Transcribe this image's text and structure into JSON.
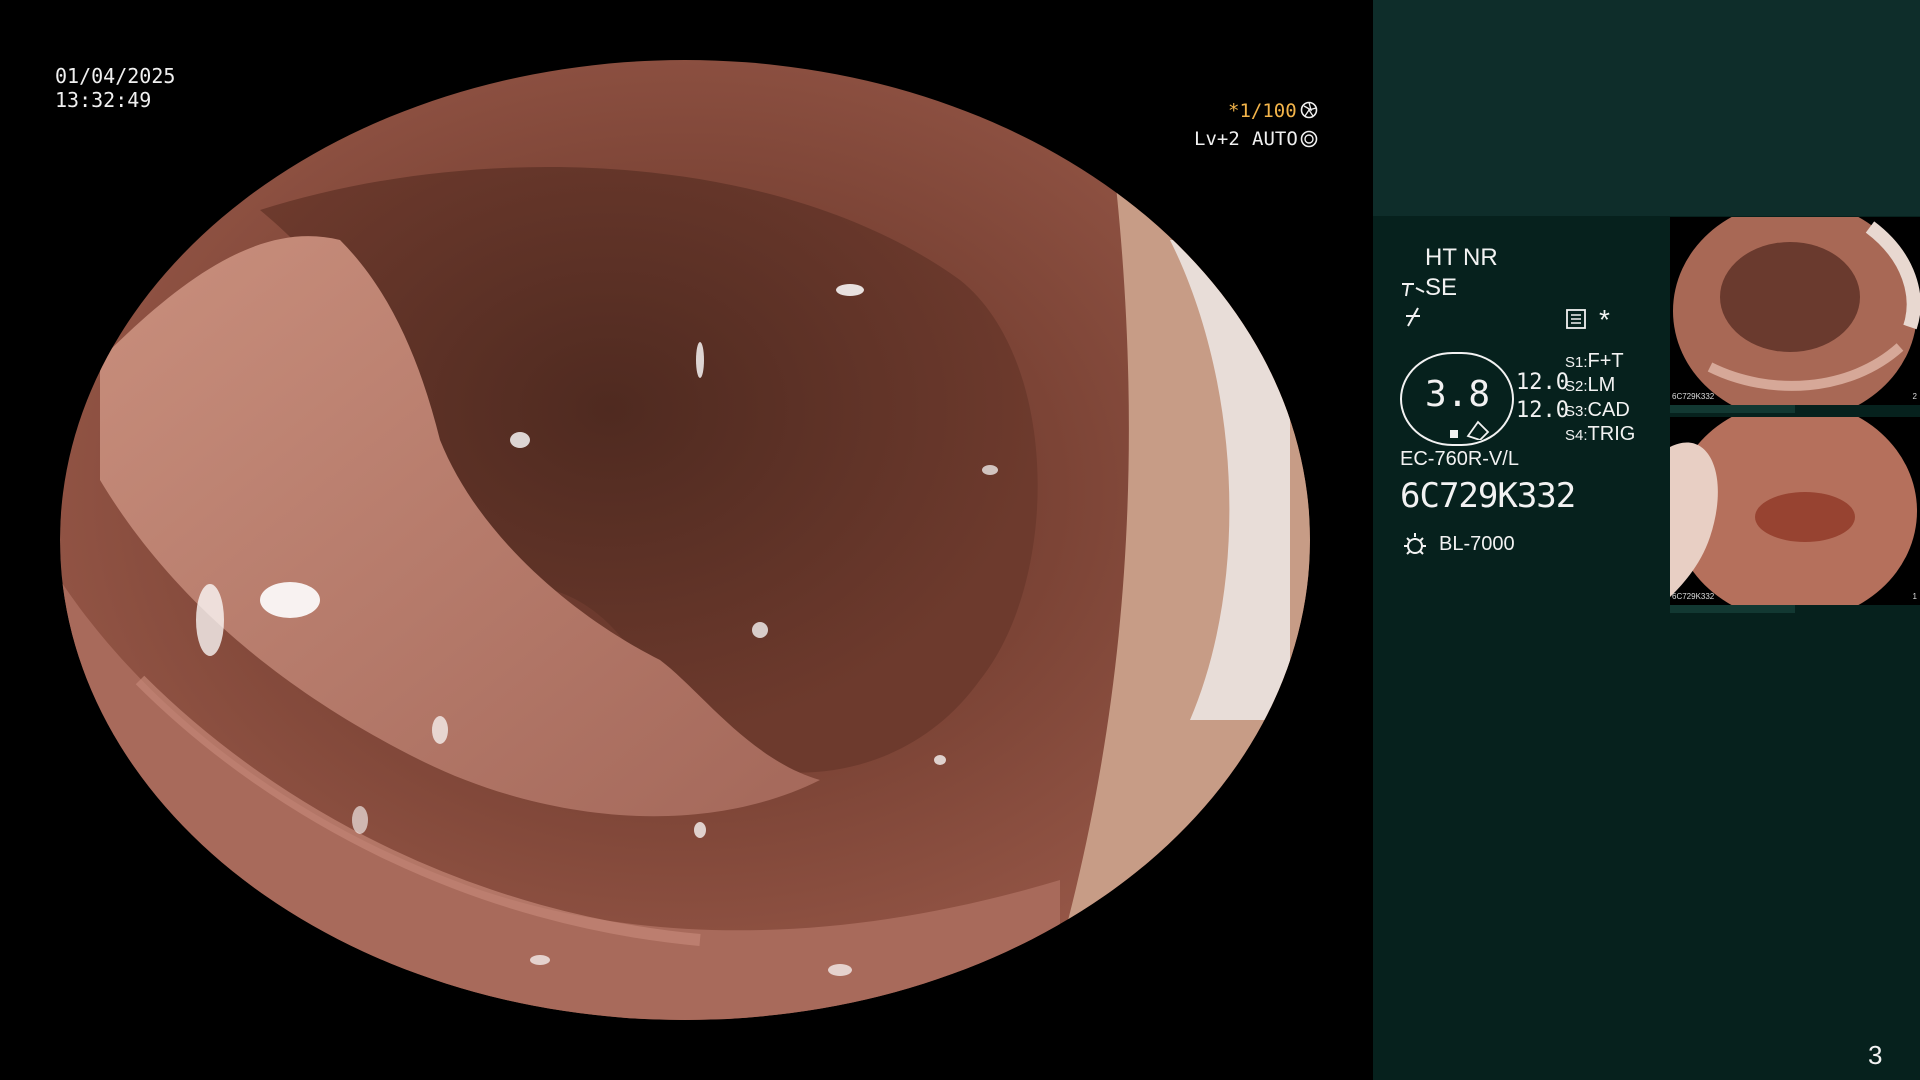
{
  "osd": {
    "date": "01/04/2025",
    "time": "13:32:49",
    "shutter": "*1/100",
    "level": "Lv+2",
    "exposure": "AUTO"
  },
  "panel": {
    "mode_ht": "HT",
    "mode_nr": "NR",
    "mode_se": "SE",
    "asterisk": "*",
    "zoom_value": "3.8",
    "value_1": "12.0",
    "value_2": "12.0",
    "switches": [
      {
        "key": "S1",
        "value": "F+T"
      },
      {
        "key": "S2",
        "value": "LM"
      },
      {
        "key": "S3",
        "value": "CAD"
      },
      {
        "key": "S4",
        "value": "TRIG"
      }
    ],
    "scope_model": "EC-760R-V/L",
    "scope_serial": "6C729K332",
    "light_source": "BL-7000"
  },
  "thumbnails": [
    {
      "caption": "6C729K332",
      "index": "2"
    },
    {
      "caption": "6C729K332",
      "index": "1"
    }
  ],
  "page_number": "3",
  "colors": {
    "accent_yellow": "#f3b44a",
    "panel_bg": "#06211d",
    "panel_top": "#0e2d2a",
    "mucosa": "#a0645a"
  },
  "icons": [
    "shutter-icon",
    "auto-exposure-icon",
    "structure-enhance-icon",
    "color-icon",
    "memory-icon",
    "light-source-icon"
  ]
}
